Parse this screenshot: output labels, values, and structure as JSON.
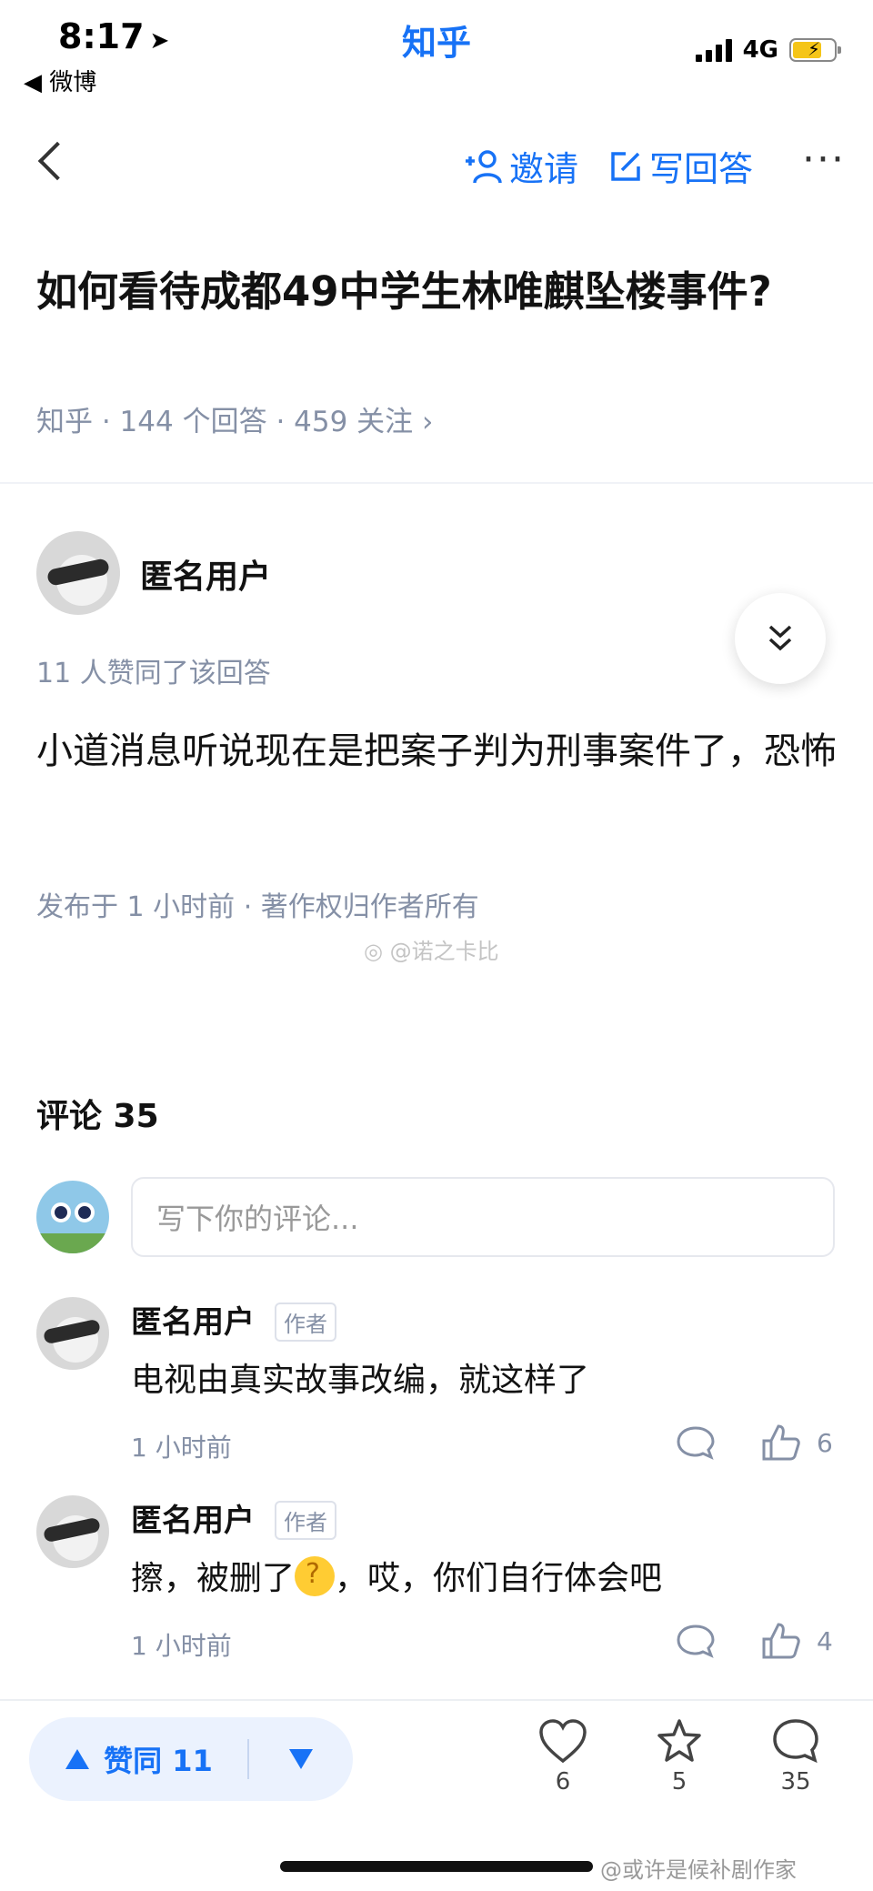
{
  "status": {
    "time": "8:17",
    "back_app": "◀ 微博",
    "app_name": "知乎",
    "network": "4G"
  },
  "nav": {
    "invite_label": "邀请",
    "write_label": "写回答",
    "more_label": "···"
  },
  "question": {
    "title": "如何看待成都49中学生林唯麒坠楼事件?",
    "meta": "知乎 · 144 个回答 · 459 关注 ›"
  },
  "answer": {
    "author": "匿名用户",
    "votes_text": "11 人赞同了该回答",
    "content": "小道消息听说现在是把案子判为刑事案件了，恐怖",
    "footer": "发布于 1 小时前 · 著作权归作者所有",
    "watermark": "@诺之卡比"
  },
  "comments": {
    "title": "评论 35",
    "input_placeholder": "写下你的评论...",
    "items": [
      {
        "author": "匿名用户",
        "tag": "作者",
        "text_before": "电视由真实故事改编，就这样了",
        "text_after": "",
        "time": "1 小时前",
        "likes": "6"
      },
      {
        "author": "匿名用户",
        "tag": "作者",
        "text_before": "擦，被删了",
        "text_after": "，哎，你们自行体会吧",
        "time": "1 小时前",
        "likes": "4"
      }
    ]
  },
  "bottom_bar": {
    "vote_label": "赞同 11",
    "like_count": "6",
    "favorite_count": "5",
    "comment_count": "35",
    "watermark": "@或许是候补剧作家"
  },
  "colors": {
    "brand_blue": "#1772f6",
    "meta_gray": "#8590a6"
  }
}
